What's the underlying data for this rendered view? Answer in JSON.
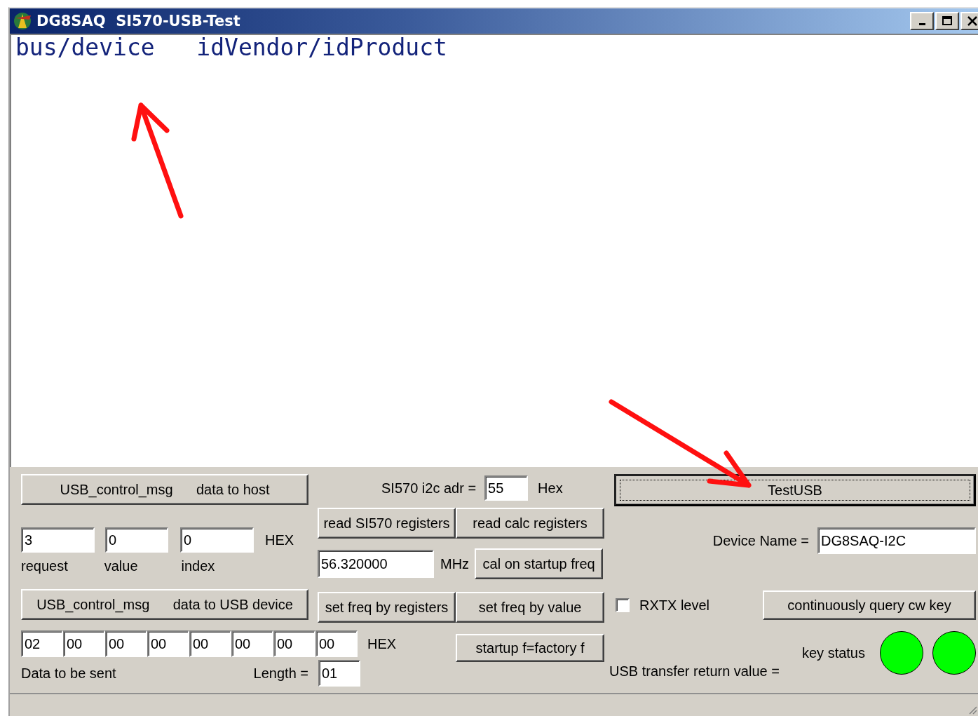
{
  "window": {
    "title": "DG8SAQ  SI570-USB-Test"
  },
  "output": {
    "lines": [
      "bus/device   idVendor/idProduct"
    ]
  },
  "control_in": {
    "button": "USB_control_msg      data to host",
    "fields": [
      {
        "label": "request",
        "value": "3"
      },
      {
        "label": "value",
        "value": "0"
      },
      {
        "label": "index",
        "value": "0"
      }
    ],
    "unit": "HEX"
  },
  "control_out": {
    "button": "USB_control_msg      data to USB device",
    "fields": [
      "02",
      "00",
      "00",
      "00",
      "00",
      "00",
      "00",
      "00"
    ],
    "unit": "HEX",
    "caption": "Data to be sent",
    "length_label": "Length =",
    "length": "01"
  },
  "si570": {
    "address_label": "SI570 i2c adr =",
    "address": "55",
    "address_unit": "Hex",
    "read_buttons": [
      "read SI570 registers",
      "read calc registers"
    ],
    "frequency": "56.320000",
    "frequency_unit": "MHz",
    "cal_button": "cal on startup freq",
    "set_buttons": [
      "set freq by registers",
      "set freq by value"
    ],
    "factory_button": "startup f=factory f"
  },
  "test_button": {
    "label": "TestUSB",
    "focused": true
  },
  "device_name": {
    "label": "Device Name =",
    "value": "DG8SAQ-I2C"
  },
  "rxtx": {
    "label": "RXTX level",
    "checked": false
  },
  "query_button": "continuously query cw key",
  "key_status": {
    "label": "key status",
    "leds": [
      {
        "color": "#00ff00"
      },
      {
        "color": "#00ff00"
      }
    ]
  },
  "return_value_label": "USB transfer return value ="
}
